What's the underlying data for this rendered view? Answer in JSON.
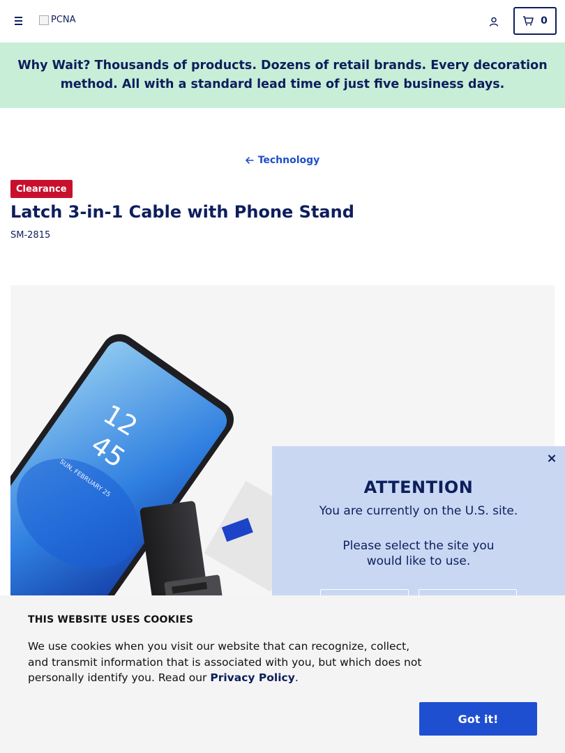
{
  "header": {
    "logo_alt": "PCNA",
    "cart_count": "0"
  },
  "promo": {
    "lead": "Why Wait?",
    "text": " Thousands of products. Dozens of retail brands. Every decoration method. All with a standard lead time of just five business days."
  },
  "breadcrumb": {
    "label": "Technology"
  },
  "product": {
    "badge": "Clearance",
    "title": "Latch 3-in-1 Cable with Phone Stand",
    "sku": "SM-2815",
    "image": {
      "screen_time": "12\n45",
      "screen_date": "SUN, FEBRUARY 25"
    }
  },
  "site_modal": {
    "close": "×",
    "title": "ATTENTION",
    "line1": "You are currently on the U.S. site.",
    "line2": "Please select the site you would like to use."
  },
  "cookie": {
    "title": "THIS WEBSITE USES COOKIES",
    "text_before": "We use cookies when you visit our website that can recognize, collect, and transmit information that is associated with you, but which does not personally identify you. Read our ",
    "policy_link": "Privacy Policy",
    "text_after": ".",
    "accept": "Got it!"
  },
  "colors": {
    "navy": "#0d1e5c",
    "promo_bg": "#c8eed8",
    "link_blue": "#1f4fc7",
    "badge_red": "#c8102e",
    "modal_bg": "#c9d7f3",
    "cta_blue": "#1f4fd1"
  }
}
